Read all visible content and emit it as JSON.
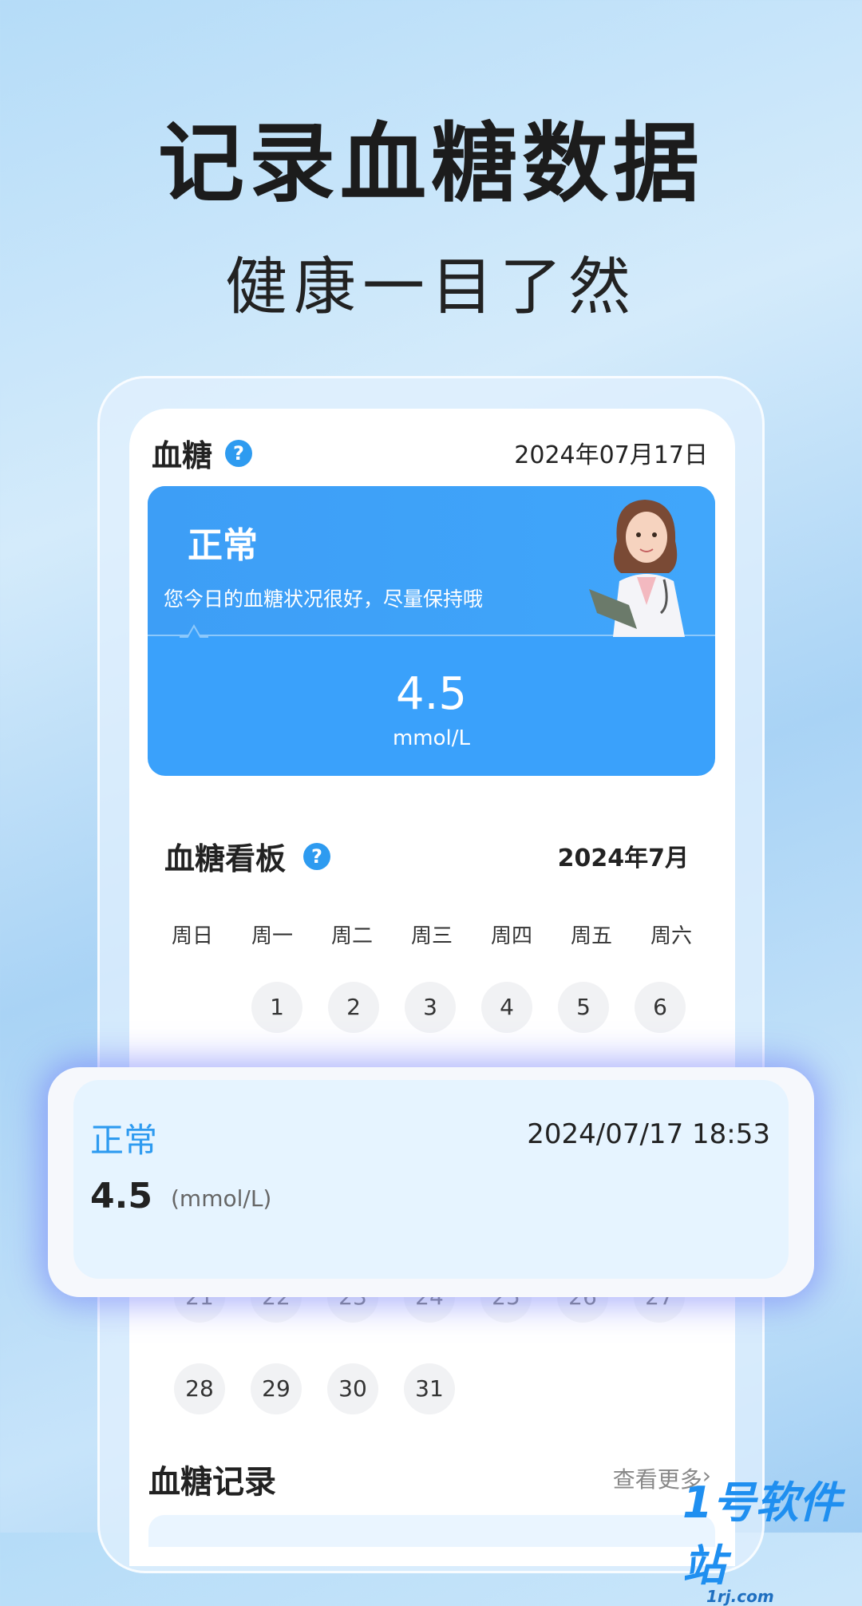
{
  "hero": {
    "title": "记录血糖数据",
    "subtitle": "健康一目了然"
  },
  "header": {
    "title": "血糖",
    "help_icon": "question-circle-icon",
    "help_glyph": "?",
    "date": "2024年07月17日"
  },
  "status_card": {
    "status": "正常",
    "message": "您今日的血糖状况很好，尽量保持哦",
    "value": "4.5",
    "unit": "mmol/L",
    "color": "#3aa1fb"
  },
  "board": {
    "title": "血糖看板",
    "month": "2024年7月",
    "weekdays": [
      "周日",
      "周一",
      "周二",
      "周三",
      "周四",
      "周五",
      "周六"
    ],
    "week1": [
      "1",
      "2",
      "3",
      "4",
      "5",
      "6"
    ],
    "week_partial": [
      "21",
      "22",
      "23",
      "24",
      "25",
      "26",
      "27"
    ],
    "week_last": [
      "28",
      "29",
      "30",
      "31"
    ]
  },
  "popup": {
    "status": "正常",
    "datetime": "2024/07/17 18:53",
    "value": "4.5",
    "unit": "(mmol/L)",
    "status_color": "#2e9bf0"
  },
  "records": {
    "title": "血糖记录",
    "more": "查看更多",
    "more_icon": "chevron-right-icon",
    "more_glyph": "›"
  },
  "watermark": {
    "text": "1号软件站",
    "sub": "1rj.com"
  }
}
